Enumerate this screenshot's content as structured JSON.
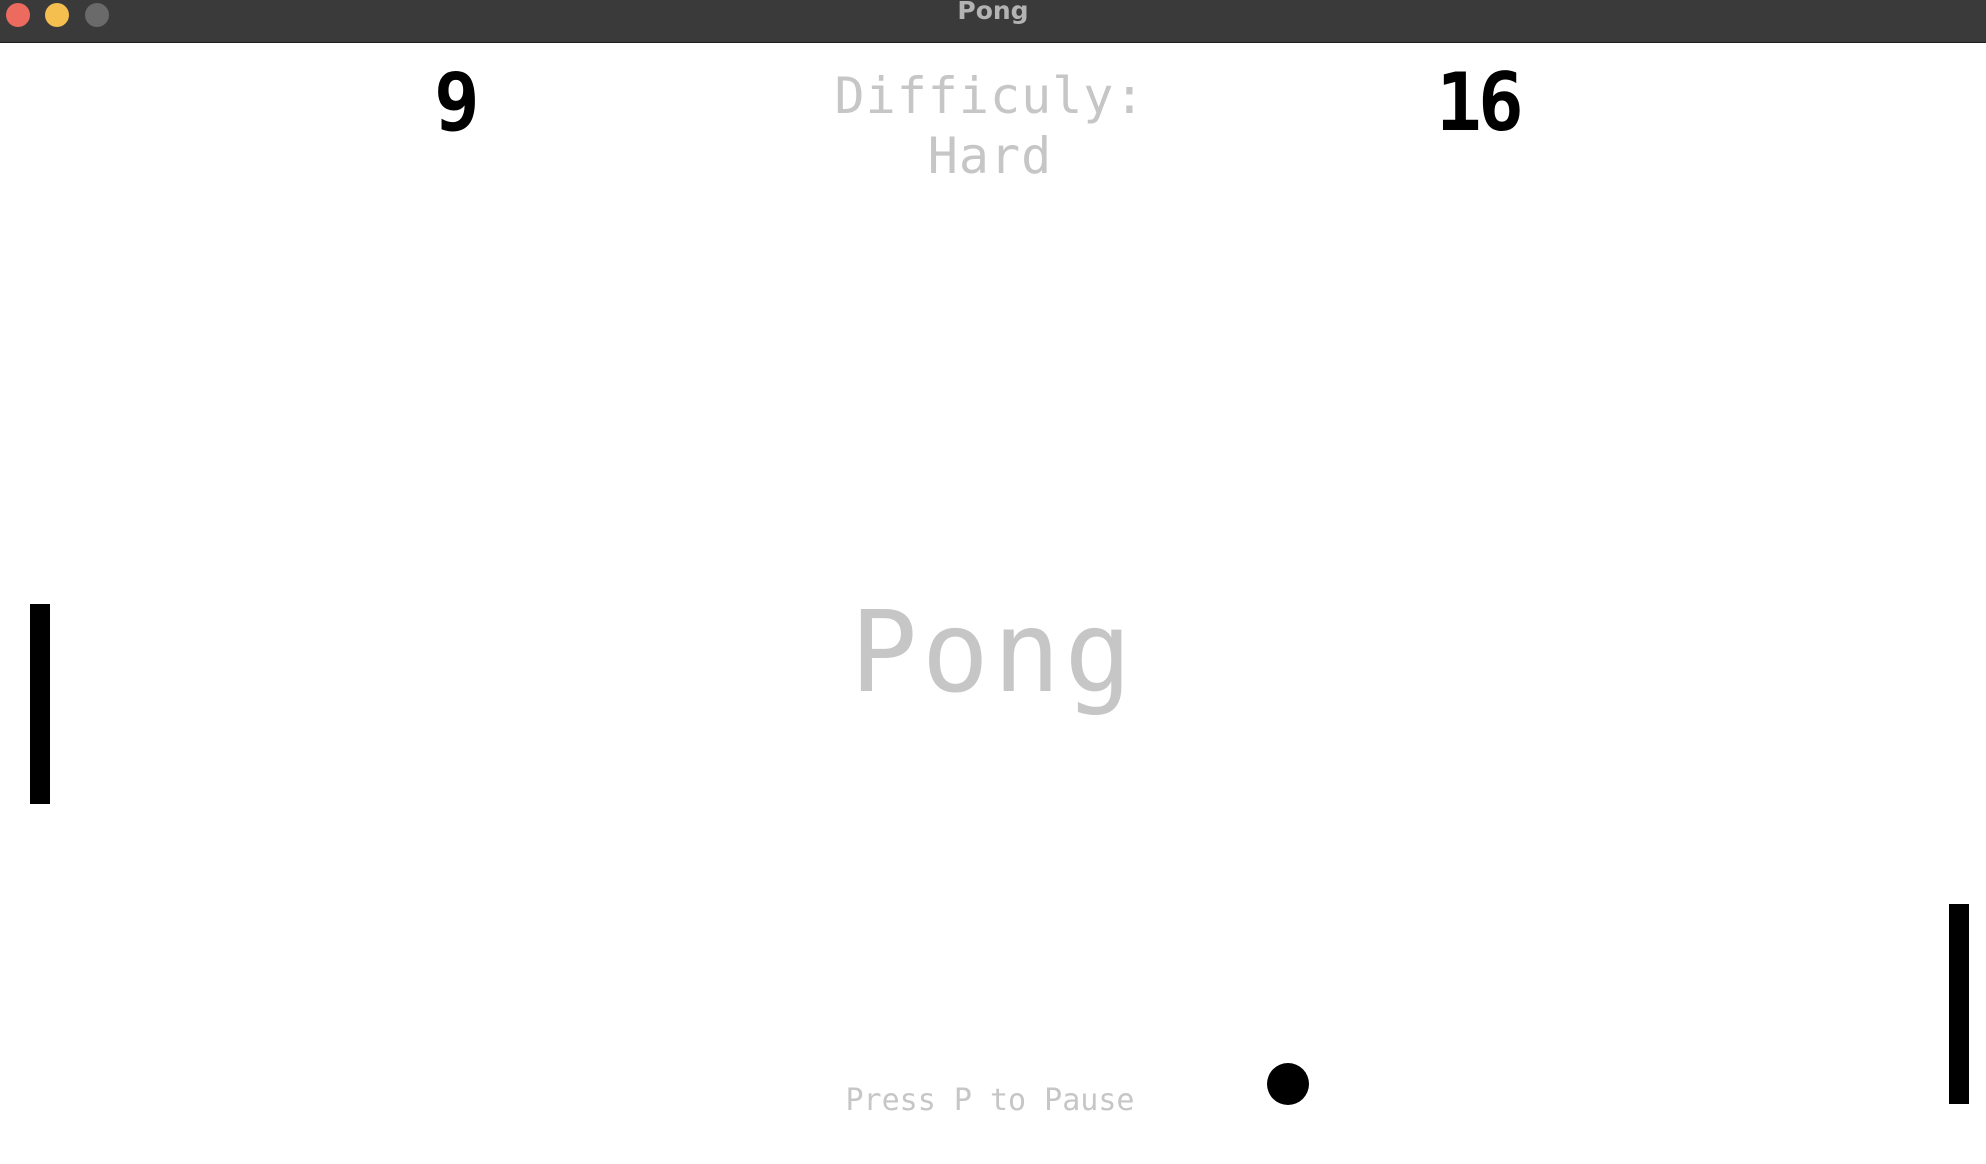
{
  "window": {
    "title": "Pong",
    "buttons": {
      "close_color": "#ec6a5e",
      "minimize_color": "#f4bf4f",
      "zoom_color": "#6a6a6a"
    }
  },
  "game": {
    "score_left": "9",
    "score_right": "16",
    "difficulty": "Difficuly: Hard",
    "title": "Pong",
    "pause_hint": "Press P to Pause"
  },
  "colors": {
    "titlebar": "#3a3a3a",
    "background": "#ffffff",
    "paddle": "#000000",
    "ball": "#000000",
    "muted_text": "#c6c6c6"
  }
}
